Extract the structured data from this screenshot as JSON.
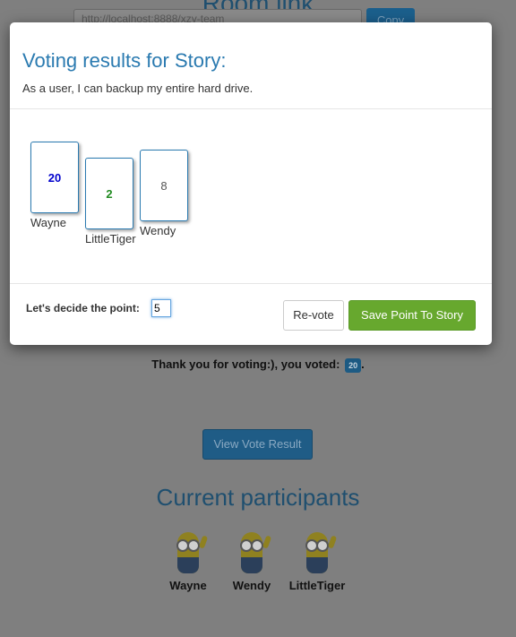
{
  "background": {
    "title": "Room link",
    "room_url": "http://localhost:8888/xzy-team",
    "copy_label": "Copy",
    "thanks_text": "Thank you for voting:), you voted:",
    "voted_value": "20",
    "view_result_label": "View Vote Result",
    "participants_title": "Current participants",
    "participants": [
      {
        "name": "Wayne"
      },
      {
        "name": "Wendy"
      },
      {
        "name": "LittleTiger"
      }
    ]
  },
  "modal": {
    "title": "Voting results for Story:",
    "story": "As a user, I can backup my entire hard drive.",
    "votes": [
      {
        "value": "20",
        "name": "Wayne",
        "color": "#0000cc"
      },
      {
        "value": "2",
        "name": "LittleTiger",
        "color": "#228b22"
      },
      {
        "value": "8",
        "name": "Wendy",
        "color": "#555555"
      }
    ],
    "decide_label": "Let's decide the point:",
    "point_value": "5",
    "revote_label": "Re-vote",
    "save_label": "Save Point To Story"
  }
}
